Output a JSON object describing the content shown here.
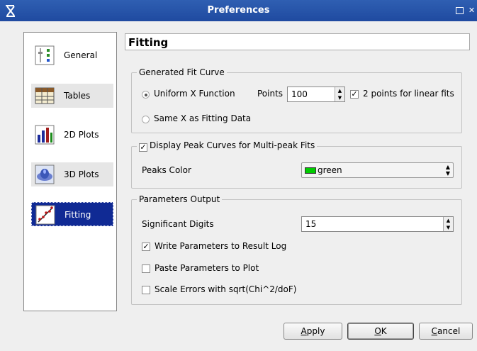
{
  "window": {
    "title": "Preferences",
    "max_glyph": "▫",
    "close_glyph": "✕"
  },
  "sidebar": {
    "items": [
      {
        "label": "General",
        "icon": "general-settings-icon"
      },
      {
        "label": "Tables",
        "icon": "table-icon"
      },
      {
        "label": "2D Plots",
        "icon": "bar-chart-icon"
      },
      {
        "label": "3D Plots",
        "icon": "surface-plot-icon"
      },
      {
        "label": "Fitting",
        "icon": "fit-line-icon"
      }
    ],
    "selected": "Fitting"
  },
  "page": {
    "title": "Fitting"
  },
  "fit_curve": {
    "legend": "Generated Fit Curve",
    "uniform_label": "Uniform X Function",
    "points_label": "Points",
    "points_value": "100",
    "linear_label": "2 points for linear fits",
    "same_x_label": "Same X as Fitting Data"
  },
  "peaks": {
    "legend": "Display Peak Curves for Multi-peak Fits",
    "color_label": "Peaks Color",
    "color_value": "green",
    "color_hex": "#00cc00"
  },
  "params": {
    "legend": "Parameters Output",
    "digits_label": "Significant Digits",
    "digits_value": "15",
    "write_log_label": "Write Parameters to Result Log",
    "paste_label": "Paste Parameters to Plot",
    "scale_label": "Scale Errors with sqrt(Chi^2/doF)"
  },
  "buttons": {
    "apply_mnemonic": "A",
    "apply_rest": "pply",
    "ok_mnemonic": "O",
    "ok_rest": "K",
    "cancel_mnemonic": "C",
    "cancel_rest": "ancel"
  }
}
